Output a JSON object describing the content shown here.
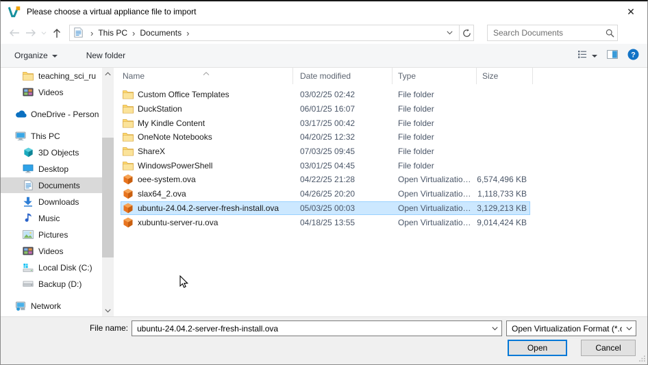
{
  "window": {
    "title": "Please choose a virtual appliance file to import",
    "close_glyph": "✕"
  },
  "nav": {
    "crumbs": [
      "This PC",
      "Documents"
    ],
    "search_placeholder": "Search Documents"
  },
  "toolbar": {
    "organize_label": "Organize",
    "new_folder_label": "New folder"
  },
  "sidebar": {
    "items": [
      {
        "label": "teaching_sci_ru",
        "icon": "folder",
        "indent": 2
      },
      {
        "label": "Videos",
        "icon": "video",
        "indent": 2
      },
      {
        "label": "OneDrive - Person",
        "icon": "cloud",
        "indent": 1,
        "group_start": true
      },
      {
        "label": "This PC",
        "icon": "computer",
        "indent": 1,
        "group_start": true
      },
      {
        "label": "3D Objects",
        "icon": "cube3d",
        "indent": 2
      },
      {
        "label": "Desktop",
        "icon": "desktop",
        "indent": 2
      },
      {
        "label": "Documents",
        "icon": "document",
        "indent": 2,
        "selected": true
      },
      {
        "label": "Downloads",
        "icon": "download",
        "indent": 2
      },
      {
        "label": "Music",
        "icon": "music",
        "indent": 2
      },
      {
        "label": "Pictures",
        "icon": "picture",
        "indent": 2
      },
      {
        "label": "Videos",
        "icon": "video",
        "indent": 2
      },
      {
        "label": "Local Disk (C:)",
        "icon": "disk_windows",
        "indent": 2
      },
      {
        "label": "Backup (D:)",
        "icon": "disk",
        "indent": 2
      },
      {
        "label": "Network",
        "icon": "network",
        "indent": 1,
        "group_start": true
      }
    ]
  },
  "files": {
    "columns": [
      "Name",
      "Date modified",
      "Type",
      "Size"
    ],
    "rows": [
      {
        "name": "Custom Office Templates",
        "date": "03/02/25 02:42",
        "type": "File folder",
        "size": "",
        "icon": "folder"
      },
      {
        "name": "DuckStation",
        "date": "06/01/25 16:07",
        "type": "File folder",
        "size": "",
        "icon": "folder"
      },
      {
        "name": "My Kindle Content",
        "date": "03/17/25 00:42",
        "type": "File folder",
        "size": "",
        "icon": "folder"
      },
      {
        "name": "OneNote Notebooks",
        "date": "04/20/25 12:32",
        "type": "File folder",
        "size": "",
        "icon": "folder"
      },
      {
        "name": "ShareX",
        "date": "07/03/25 09:45",
        "type": "File folder",
        "size": "",
        "icon": "folder"
      },
      {
        "name": "WindowsPowerShell",
        "date": "03/01/25 04:45",
        "type": "File folder",
        "size": "",
        "icon": "folder"
      },
      {
        "name": "oee-system.ova",
        "date": "04/22/25 21:28",
        "type": "Open Virtualizatio…",
        "size": "6,574,496 KB",
        "icon": "ova"
      },
      {
        "name": "slax64_2.ova",
        "date": "04/26/25 20:20",
        "type": "Open Virtualizatio…",
        "size": "1,118,733 KB",
        "icon": "ova"
      },
      {
        "name": "ubuntu-24.04.2-server-fresh-install.ova",
        "date": "05/03/25 00:03",
        "type": "Open Virtualizatio…",
        "size": "3,129,213 KB",
        "icon": "ova",
        "selected": true
      },
      {
        "name": "xubuntu-server-ru.ova",
        "date": "04/18/25 13:55",
        "type": "Open Virtualizatio…",
        "size": "9,014,424 KB",
        "icon": "ova"
      }
    ]
  },
  "footer": {
    "file_name_label": "File name:",
    "file_name_value": "ubuntu-24.04.2-server-fresh-install.ova",
    "file_type_value": "Open Virtualization Format (*.o",
    "open_label": "Open",
    "cancel_label": "Cancel"
  },
  "colors": {
    "accent_blue": "#0078d7",
    "selection_bg": "#cce8ff",
    "selection_border": "#99d1ff",
    "sidebar_selected_bg": "#d9d9d9"
  }
}
